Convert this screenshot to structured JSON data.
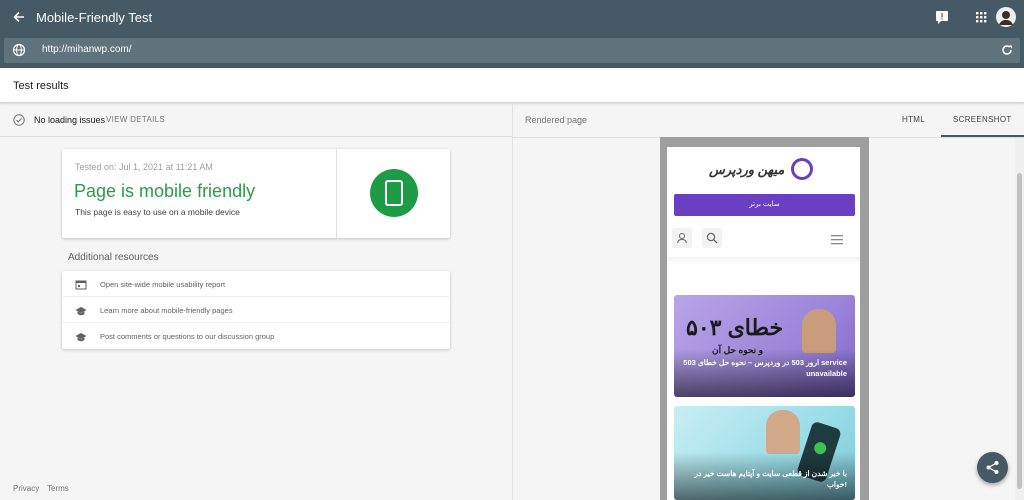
{
  "app": {
    "title": "Mobile-Friendly Test"
  },
  "urlbar": {
    "url": "http://mihanwp.com/"
  },
  "results": {
    "heading": "Test results"
  },
  "status": {
    "label": "No loading issues",
    "view_details": "VIEW DETAILS"
  },
  "summary_card": {
    "tested_on": "Tested on: Jul 1, 2021 at 11:21 AM",
    "verdict": "Page is mobile friendly",
    "description": "This page is easy to use on a mobile device",
    "accent_color": "#1e9c45"
  },
  "resources": {
    "heading": "Additional resources",
    "items": [
      {
        "icon": "report-icon",
        "label": "Open site-wide mobile usability report"
      },
      {
        "icon": "school-icon",
        "label": "Learn more about mobile-friendly pages"
      },
      {
        "icon": "school-icon",
        "label": "Post comments or questions to our discussion group"
      }
    ]
  },
  "footer": {
    "privacy": "Privacy",
    "terms": "Terms"
  },
  "rendered": {
    "label": "Rendered page",
    "tabs": [
      {
        "label": "HTML",
        "selected": false
      },
      {
        "label": "SCREENSHOT",
        "selected": true
      }
    ]
  },
  "mobile_preview": {
    "logo_text": "میهن وردپرس",
    "top_button": "سایت برتر",
    "post1_title": "خطای ۵۰۳",
    "post1_subtitle": "و نحوه حل آن",
    "post1_caption": "ارور 503 در وردپرس – نحوه حل خطای 503 service unavailable",
    "post2_caption": "با خبر شدن از قطعی سایت و آپتایم هاست خیر در خواب!"
  },
  "colors": {
    "appbar": "#455a64",
    "brand_purple": "#6a3fc1",
    "success": "#2e9a4b"
  }
}
